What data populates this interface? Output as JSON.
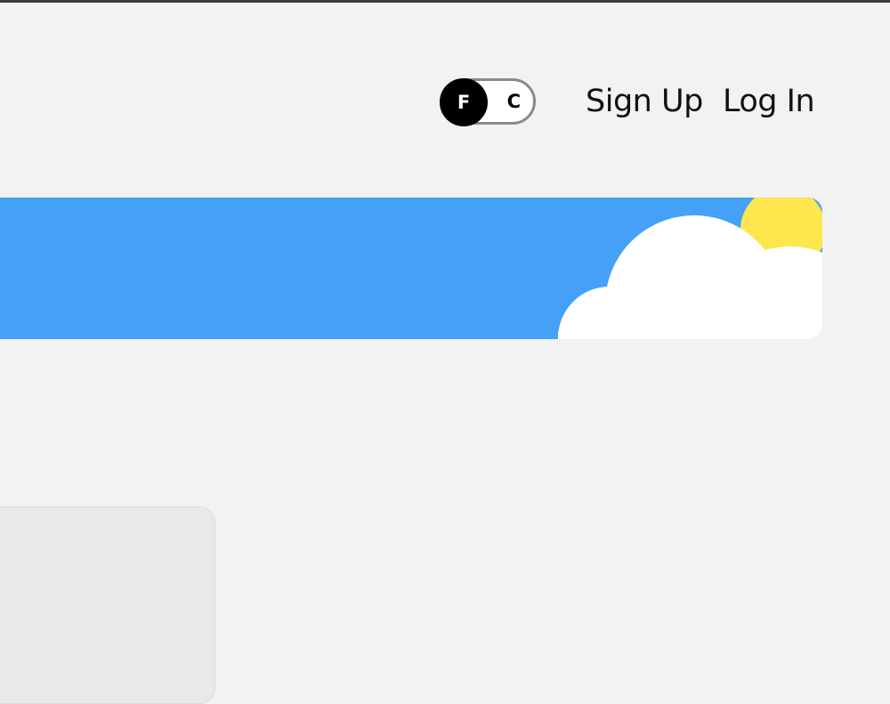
{
  "header": {
    "unit_toggle": {
      "selected": "F",
      "other": "C"
    },
    "sign_up_label": "Sign Up",
    "log_in_label": "Log In"
  },
  "banner": {
    "background_color": "#45a1f8",
    "sun_color": "#fde74c",
    "cloud_color": "#ffffff",
    "icons": [
      "sun-icon",
      "cloud-icon"
    ]
  }
}
